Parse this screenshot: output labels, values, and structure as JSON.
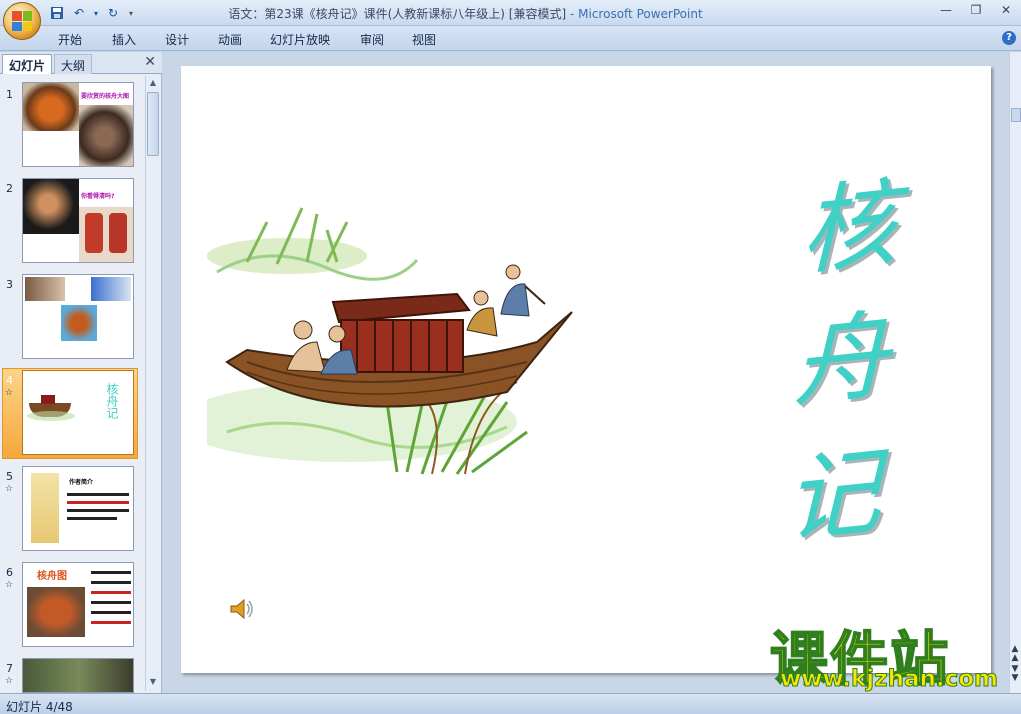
{
  "window": {
    "title": "语文：第23课《核舟记》课件(人教新课标八年级上) [兼容模式]",
    "app_suffix": "- Microsoft PowerPoint",
    "controls": [
      "—",
      "❐",
      "✕"
    ]
  },
  "ribbon": {
    "tabs": [
      "开始",
      "插入",
      "设计",
      "动画",
      "幻灯片放映",
      "审阅",
      "视图"
    ]
  },
  "panel": {
    "tab_slides": "幻灯片",
    "tab_outline": "大纲",
    "close": "✕"
  },
  "thumbnails": [
    {
      "num": "1",
      "text": "要欣赏的核舟大图"
    },
    {
      "num": "2",
      "text": "你看得清吗?"
    },
    {
      "num": "3",
      "text": ""
    },
    {
      "num": "4",
      "text": "核舟记"
    },
    {
      "num": "5",
      "text": "作者简介"
    },
    {
      "num": "6",
      "text": "核舟图"
    },
    {
      "num": "7",
      "text": ""
    }
  ],
  "slide": {
    "title_chars": [
      "核",
      "舟",
      "记"
    ]
  },
  "watermark": {
    "cn": "课件站",
    "url": "www.kjzhan.com"
  },
  "status": {
    "slide_indicator": "幻灯片 4/48"
  },
  "colors": {
    "title_teal": "#3fd0c6",
    "selection_orange": "#f6a73a"
  }
}
